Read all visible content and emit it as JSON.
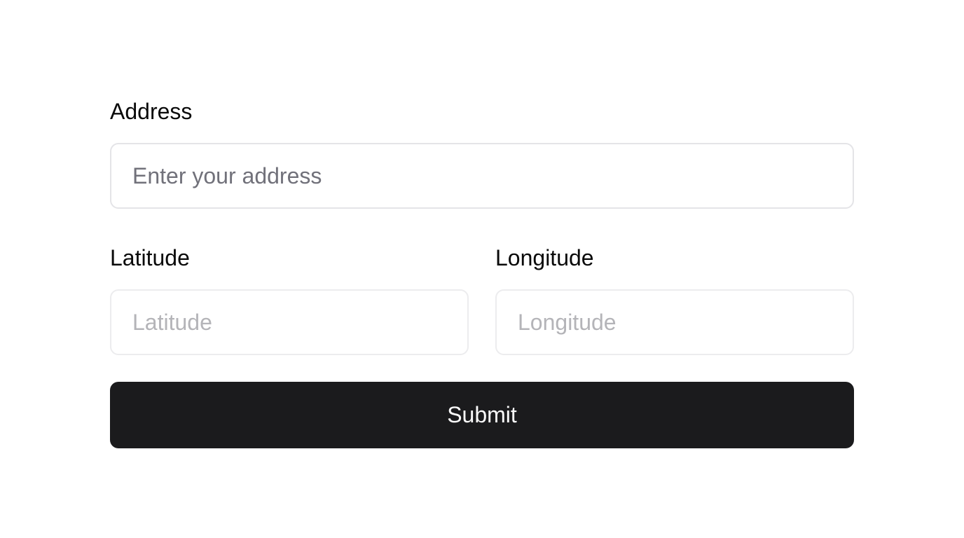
{
  "form": {
    "address": {
      "label": "Address",
      "placeholder": "Enter your address",
      "value": ""
    },
    "latitude": {
      "label": "Latitude",
      "placeholder": "Latitude",
      "value": ""
    },
    "longitude": {
      "label": "Longitude",
      "placeholder": "Longitude",
      "value": ""
    },
    "submit_label": "Submit"
  },
  "colors": {
    "button_background": "#1b1b1d",
    "button_text": "#fafafa",
    "input_border": "#e4e4e7",
    "placeholder_address": "#71717a",
    "placeholder_coord": "#b4b4b8"
  }
}
